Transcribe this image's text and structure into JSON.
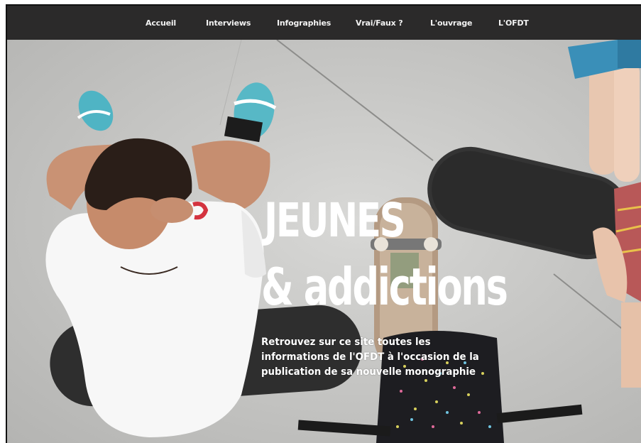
{
  "nav": {
    "items": [
      {
        "label": "Accueil"
      },
      {
        "label": "Interviews"
      },
      {
        "label": "Infographies"
      },
      {
        "label": "Vrai/Faux ?"
      },
      {
        "label": "L'ouvrage"
      },
      {
        "label": "L'OFDT"
      }
    ]
  },
  "hero": {
    "title_line1": "JEUNES",
    "title_line2": "& addictions",
    "intro": "Retrouvez sur ce site toutes les informations de l'OFDT à l'occasion de la publication de sa nouvelle monographie"
  }
}
